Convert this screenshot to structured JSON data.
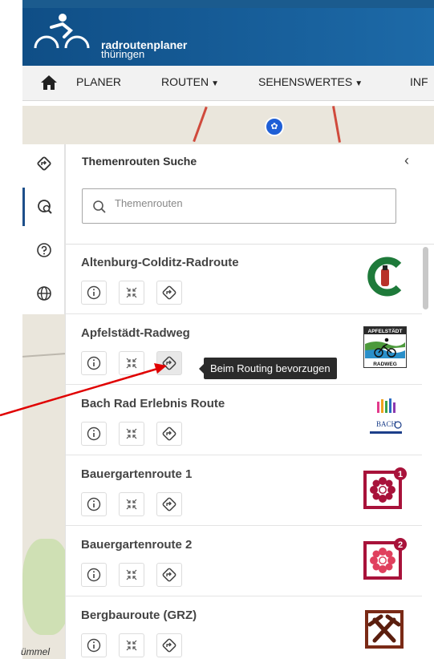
{
  "brand": {
    "name": "radroutenplaner",
    "region": "thüringen"
  },
  "nav": {
    "items": [
      {
        "label": "PLANER",
        "caret": ""
      },
      {
        "label": "ROUTEN",
        "caret": "▼"
      },
      {
        "label": "SEHENSWERTES",
        "caret": "▼"
      },
      {
        "label": "INF",
        "caret": ""
      }
    ]
  },
  "rail": {
    "items": [
      "route-icon",
      "theme-search-icon",
      "help-icon",
      "globe-icon"
    ],
    "active_index": 1
  },
  "panel": {
    "title": "Themenrouten Suche",
    "close_glyph": "‹",
    "search": {
      "value": "",
      "placeholder": "Themenrouten"
    }
  },
  "routes": [
    {
      "name": "Altenburg-Colditz-Radroute",
      "logo": "altenburg-colditz-logo"
    },
    {
      "name": "Apfelstädt-Radweg",
      "logo": "apfelstaedt-radweg-logo",
      "logo_text_top": "APFELSTÄDT",
      "logo_text_bottom": "RADWEG",
      "routing_pressed": true
    },
    {
      "name": "Bach Rad Erlebnis Route",
      "logo": "bach-rad-logo",
      "logo_text": "BACH"
    },
    {
      "name": "Bauergartenroute 1",
      "logo": "bauergarten-1-logo",
      "badge": "1"
    },
    {
      "name": "Bauergartenroute 2",
      "logo": "bauergarten-2-logo",
      "badge": "2"
    },
    {
      "name": "Bergbauroute (GRZ)",
      "logo": "bergbau-logo"
    }
  ],
  "tooltip": "Beim Routing bevorzugen",
  "map": {
    "label": "ümmel"
  },
  "colors": {
    "header": "#1b5b8e",
    "annotation_arrow": "#e00000",
    "bauergarten": "#a8123a"
  }
}
